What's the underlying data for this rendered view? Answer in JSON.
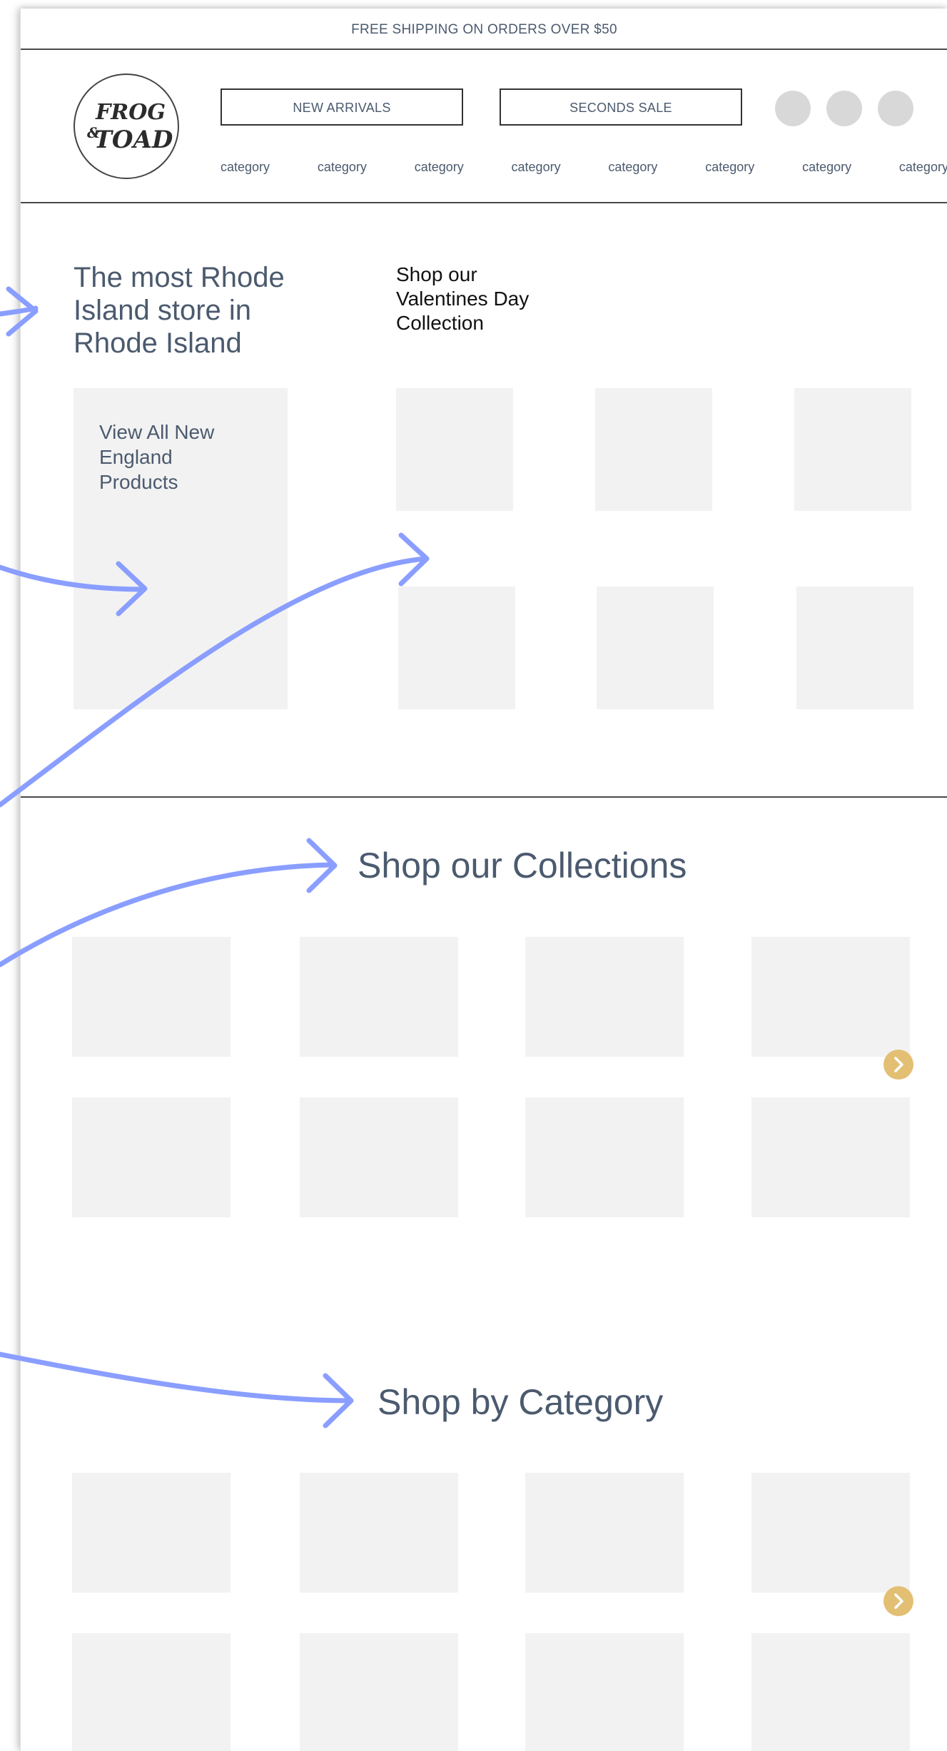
{
  "promo_bar": {
    "text": "FREE SHIPPING ON ORDERS OVER $50"
  },
  "logo": {
    "text": "Frog & Toad"
  },
  "header": {
    "new_arrivals_label": "NEW ARRIVALS",
    "seconds_sale_label": "SECONDS SALE",
    "icons": [
      "account-icon",
      "search-icon",
      "cart-icon"
    ],
    "categories": [
      "category",
      "category",
      "category",
      "category",
      "category",
      "category",
      "category",
      "category"
    ]
  },
  "hero": {
    "headline": "The most Rhode Island store in Rhode Island",
    "valentine_heading": "Shop our Valentines Day Collection",
    "view_all_label": "View All New England Products"
  },
  "collections": {
    "title": "Shop our Collections"
  },
  "categories_section": {
    "title": "Shop by Category"
  },
  "colors": {
    "text": "#4b5a6e",
    "placeholder": "#f2f2f2",
    "icon_circle": "#d8d8d8",
    "accent": "#e3bf73",
    "annotation_arrow": "#8a9eff"
  }
}
